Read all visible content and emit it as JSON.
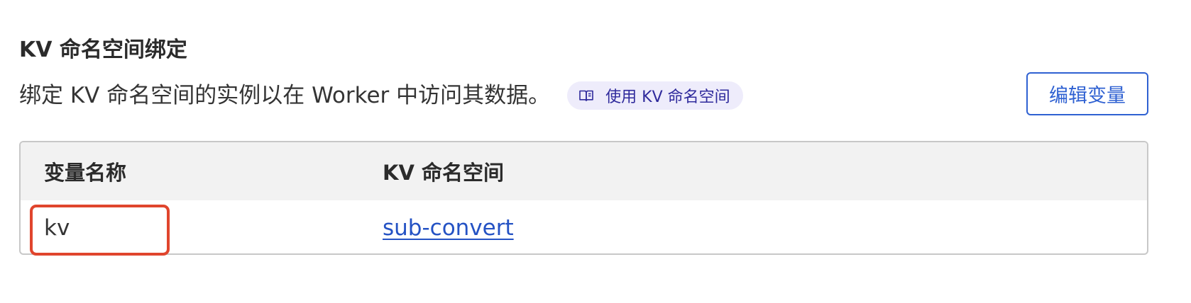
{
  "section": {
    "title": "KV 命名空间绑定",
    "description": "绑定 KV 命名空间的实例以在 Worker 中访问其数据。",
    "doc_link": {
      "label": "使用 KV 命名空间",
      "icon": "book-open-icon"
    },
    "edit_button_label": "编辑变量"
  },
  "table": {
    "headers": [
      "变量名称",
      "KV 命名空间"
    ],
    "rows": [
      {
        "variable_name": "kv",
        "namespace": "sub-convert"
      }
    ]
  },
  "annotation": {
    "highlight_color": "#e0452d",
    "highlighted_cell": "kv"
  },
  "colors": {
    "accent": "#2f61d2",
    "link": "#2452c4",
    "pill_bg": "#eeecfb",
    "pill_text": "#2f2a9c",
    "header_bg": "#f2f2f2"
  }
}
